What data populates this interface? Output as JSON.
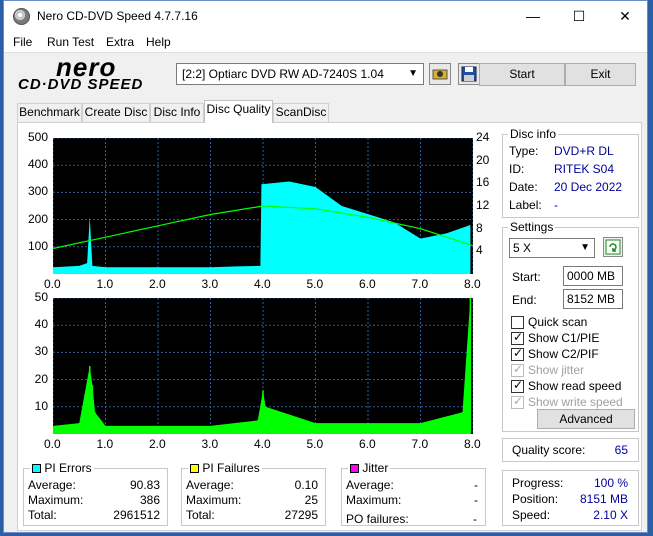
{
  "window": {
    "title": "Nero CD-DVD Speed 4.7.7.16",
    "minimize": "—",
    "maximize": "☐",
    "close": "✕"
  },
  "menu": [
    "File",
    "Run Test",
    "Extra",
    "Help"
  ],
  "logo": {
    "top": "nero",
    "bottom": "CD·DVD SPEED"
  },
  "drive": {
    "selected": "[2:2]   Optiarc DVD RW AD-7240S 1.04"
  },
  "buttons": {
    "start": "Start",
    "exit": "Exit",
    "advanced": "Advanced"
  },
  "tabs": [
    "Benchmark",
    "Create Disc",
    "Disc Info",
    "Disc Quality",
    "ScanDisc"
  ],
  "active_tab": "Disc Quality",
  "disc_info": {
    "title": "Disc info",
    "type_label": "Type:",
    "type": "DVD+R DL",
    "id_label": "ID:",
    "id": "RITEK S04",
    "date_label": "Date:",
    "date": "20 Dec 2022",
    "label_label": "Label:",
    "label": "-"
  },
  "settings": {
    "title": "Settings",
    "speed": "5 X",
    "start_label": "Start:",
    "start": "0000 MB",
    "end_label": "End:",
    "end": "8152 MB",
    "quick_scan": "Quick scan",
    "show_c1": "Show C1/PIE",
    "show_c2": "Show C2/PIF",
    "show_jitter": "Show jitter",
    "show_read": "Show read speed",
    "show_write": "Show write speed"
  },
  "quality": {
    "label": "Quality score:",
    "value": "65"
  },
  "progress": {
    "progress_label": "Progress:",
    "progress": "100 %",
    "position_label": "Position:",
    "position": "8151 MB",
    "speed_label": "Speed:",
    "speed": "2.10 X"
  },
  "pi_errors": {
    "title": "PI Errors",
    "color": "#00ffff",
    "avg_label": "Average:",
    "avg": "90.83",
    "max_label": "Maximum:",
    "max": "386",
    "total_label": "Total:",
    "total": "2961512"
  },
  "pi_failures": {
    "title": "PI Failures",
    "color": "#ffff00",
    "avg_label": "Average:",
    "avg": "0.10",
    "max_label": "Maximum:",
    "max": "25",
    "total_label": "Total:",
    "total": "27295"
  },
  "jitter": {
    "title": "Jitter",
    "color": "#ff00ff",
    "avg_label": "Average:",
    "avg": "-",
    "max_label": "Maximum:",
    "max": "-",
    "po_label": "PO failures:",
    "po": "-"
  },
  "chart_data": [
    {
      "type": "area",
      "series": [
        {
          "name": "PI Errors",
          "color": "#00ffff",
          "x": [
            0.0,
            0.5,
            0.65,
            0.7,
            0.75,
            1.0,
            2.0,
            3.0,
            3.5,
            3.95,
            3.97,
            4.5,
            5.0,
            5.5,
            6.0,
            6.5,
            7.0,
            7.5,
            7.95
          ],
          "y": [
            25,
            30,
            40,
            210,
            30,
            25,
            25,
            25,
            28,
            30,
            330,
            340,
            320,
            250,
            220,
            190,
            130,
            150,
            180
          ]
        },
        {
          "name": "Read speed",
          "color": "#00ff00",
          "x": [
            0,
            1,
            2,
            3,
            4,
            5,
            6,
            7,
            8
          ],
          "y": [
            4.5,
            6.5,
            8.5,
            10.5,
            12,
            11.5,
            10,
            8,
            5
          ]
        }
      ],
      "xlim": [
        0,
        8
      ],
      "ylim": [
        0,
        500
      ],
      "y2lim": [
        0,
        24
      ],
      "xticks": [
        "0.0",
        "1.0",
        "2.0",
        "3.0",
        "4.0",
        "5.0",
        "6.0",
        "7.0",
        "8.0"
      ],
      "yticks": [
        "500",
        "400",
        "300",
        "200",
        "100"
      ],
      "y2ticks": [
        "24",
        "20",
        "16",
        "12",
        "8",
        "4"
      ]
    },
    {
      "type": "bar",
      "series": [
        {
          "name": "PI Failures",
          "color": "#00ff00",
          "x": [
            0.0,
            0.5,
            0.7,
            0.75,
            0.8,
            1.0,
            2.0,
            3.0,
            3.9,
            4.0,
            4.05,
            5.0,
            6.0,
            7.0,
            7.8,
            7.95
          ],
          "y": [
            3,
            4,
            25,
            18,
            8,
            3,
            3,
            3,
            5,
            16,
            10,
            4,
            4,
            4,
            8,
            50
          ]
        }
      ],
      "xlim": [
        0,
        8
      ],
      "ylim": [
        0,
        50
      ],
      "xticks": [
        "0.0",
        "1.0",
        "2.0",
        "3.0",
        "4.0",
        "5.0",
        "6.0",
        "7.0",
        "8.0"
      ],
      "yticks": [
        "50",
        "40",
        "30",
        "20",
        "10"
      ]
    }
  ]
}
